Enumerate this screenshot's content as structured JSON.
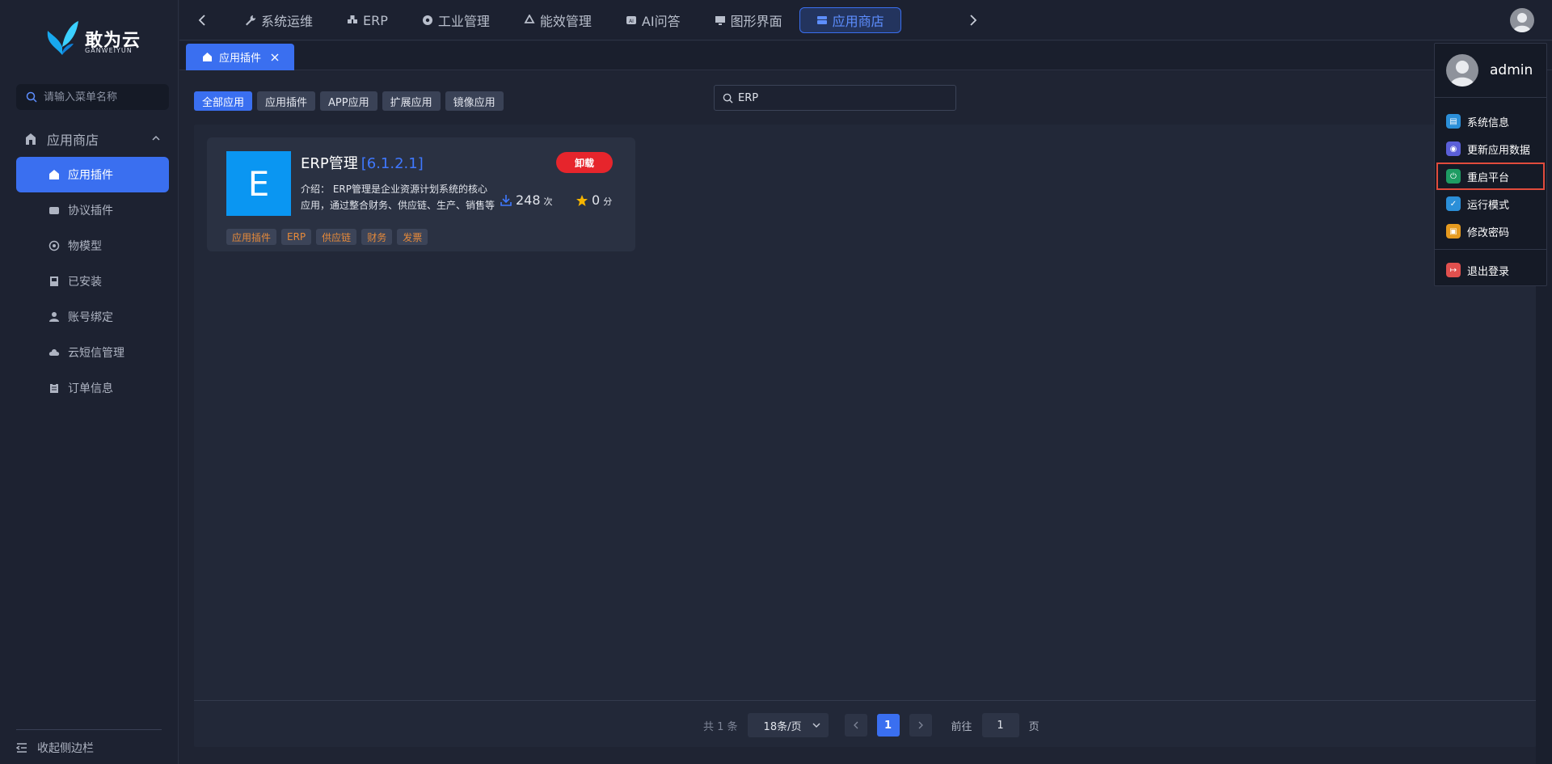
{
  "brand": {
    "name": "敢为云",
    "sub": "GANWEIYUN"
  },
  "sidebar": {
    "search_placeholder": "请输入菜单名称",
    "group_label": "应用商店",
    "items": [
      {
        "label": "应用插件",
        "icon": "shop-icon",
        "active": true
      },
      {
        "label": "协议插件",
        "icon": "plugin-icon"
      },
      {
        "label": "物模型",
        "icon": "model-icon"
      },
      {
        "label": "已安装",
        "icon": "installed-icon"
      },
      {
        "label": "账号绑定",
        "icon": "user-icon"
      },
      {
        "label": "云短信管理",
        "icon": "cloud-icon"
      },
      {
        "label": "订单信息",
        "icon": "clipboard-icon"
      }
    ],
    "collapse_label": "收起侧边栏"
  },
  "topnav": {
    "tabs": [
      {
        "label": "系统运维",
        "icon": "wrench-icon"
      },
      {
        "label": "ERP",
        "icon": "cubes-icon"
      },
      {
        "label": "工业管理",
        "icon": "gear-icon"
      },
      {
        "label": "能效管理",
        "icon": "recycle-icon"
      },
      {
        "label": "AI问答",
        "icon": "ai-icon"
      },
      {
        "label": "图形界面",
        "icon": "monitor-icon"
      },
      {
        "label": "应用商店",
        "icon": "store-icon",
        "active": true
      }
    ]
  },
  "page_tab": {
    "label": "应用插件"
  },
  "filters": [
    {
      "label": "全部应用",
      "active": true
    },
    {
      "label": "应用插件"
    },
    {
      "label": "APP应用"
    },
    {
      "label": "扩展应用"
    },
    {
      "label": "镜像应用"
    }
  ],
  "search": {
    "value": "ERP"
  },
  "app_card": {
    "logo_letter": "E",
    "name": "ERP管理",
    "version": "[6.1.2.1]",
    "uninstall_label": "卸载",
    "description": "介绍： ERP管理是企业资源计划系统的核心应用，通过整合财务、供应链、生产、销售等业务流程，实现企业资源的统一管理。",
    "downloads": "248",
    "downloads_unit": "次",
    "rating": "0",
    "rating_unit": "分",
    "tags": [
      "应用插件",
      "ERP",
      "供应链",
      "财务",
      "发票"
    ]
  },
  "pagination": {
    "total": "共 1 条",
    "page_size": "18条/页",
    "current": "1",
    "goto_label": "前往",
    "goto_value": "1",
    "page_suffix": "页"
  },
  "user_menu": {
    "username": "admin",
    "items": [
      {
        "label": "系统信息",
        "icon": "info-icon",
        "color": "#2b8fd8"
      },
      {
        "label": "更新应用数据",
        "icon": "refresh-icon",
        "color": "#5b5fd8"
      },
      {
        "label": "重启平台",
        "icon": "power-icon",
        "color": "#1e9c63",
        "highlight": true
      },
      {
        "label": "运行模式",
        "icon": "shield-icon",
        "color": "#2b8fd8"
      },
      {
        "label": "修改密码",
        "icon": "lock-icon",
        "color": "#e59a1f"
      }
    ],
    "logout_label": "退出登录",
    "logout_color": "#e0504e"
  },
  "colors": {
    "accent": "#3a6ff0",
    "danger": "#e6252c",
    "tag_text": "#e68a3a"
  }
}
